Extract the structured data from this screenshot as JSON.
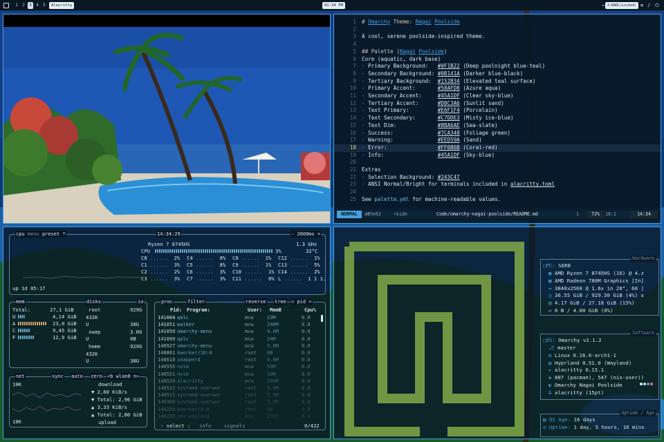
{
  "colors": {
    "accent": "#45A1DF",
    "bg": "#0B141A",
    "teal": "#152B34",
    "sand": "#D8C3A6",
    "green": "#7CA348"
  },
  "topbar": {
    "workspaces": [
      "1",
      "2",
      "3",
      "4",
      "5"
    ],
    "active_workspace": "3",
    "app_title": "Alacritty",
    "clock": "02:34 PM",
    "tray_icons": [
      "terminal-icon",
      "tag-icon",
      "bell-icon",
      "bluetooth-icon",
      "wifi-icon",
      "volume-icon",
      "battery-icon",
      "power-icon"
    ],
    "tray_label": "X:RADL(Locked)"
  },
  "editor": {
    "lines": [
      {
        "n": "1",
        "t": "# Omarchy Theme: Nagai Poolside"
      },
      {
        "n": "2",
        "t": ""
      },
      {
        "n": "3",
        "t": "A cool, serene poolside-inspired theme."
      },
      {
        "n": "4",
        "t": ""
      },
      {
        "n": "5",
        "t": "## Palette (Nagai Poolside)"
      },
      {
        "n": "6",
        "t": "Core (aquatic, dark base)"
      },
      {
        "n": "7",
        "t": "- Primary Background:   #0F1B22 (Deep poolnight blue-teal)"
      },
      {
        "n": "8",
        "t": "- Secondary Background: #0B141A (Darker blue-black)"
      },
      {
        "n": "9",
        "t": "- Tertiary Background:  #152B34 (Elevated teal surface)"
      },
      {
        "n": "10",
        "t": "- Primary Accent:       #58AFD8 (Azure aqua)"
      },
      {
        "n": "11",
        "t": "- Secondary Accent:     #45A1DF (Clear sky-blue)"
      },
      {
        "n": "12",
        "t": "- Tertiary Accent:      #D8C3A6 (Sunlit sand)"
      },
      {
        "n": "13",
        "t": "- Text Primary:         #E6F1F4 (Porcelain)"
      },
      {
        "n": "14",
        "t": "- Text Secondary:       #C7DDE3 (Misty ice-blue)"
      },
      {
        "n": "15",
        "t": "- Text Dim:             #8BA6AE (Sea-slate)"
      },
      {
        "n": "16",
        "t": "- Success:              #7CA348 (Foliage green)"
      },
      {
        "n": "17",
        "t": "- Warning:              #EED59A (Sand)"
      },
      {
        "n": "18",
        "t": "- Error:                #FF6B6B (Coral-red)"
      },
      {
        "n": "19",
        "t": "- Info:                 #45A1DF (Sky-blue)"
      },
      {
        "n": "20",
        "t": ""
      },
      {
        "n": "21",
        "t": "Extras"
      },
      {
        "n": "22",
        "t": "- Selection Background: #243C47"
      },
      {
        "n": "23",
        "t": "- ANSI Normal/Bright for terminals included in alacritty.toml"
      },
      {
        "n": "24",
        "t": ""
      },
      {
        "n": "25",
        "t": "See palette.yml for machine-readable values."
      }
    ],
    "current_line": "18",
    "status": {
      "mode": "NORMAL",
      "branch": "d45e62",
      "side": "<side",
      "path": "Code/omarchy-nagai-poolside/README.md",
      "diag": "1",
      "pct": "72%",
      "pos": "18:1",
      "time": "14:34"
    }
  },
  "btop": {
    "cpu": {
      "title": "cpu",
      "menu": "menu",
      "preset": "preset *",
      "clock": "14:34:29",
      "interval": "- 2000ms +",
      "model": "Ryzen 7 8745HS",
      "freq": "1.3 GHz",
      "total_label": "CPU",
      "total_pct": "3%",
      "temp": "32°C",
      "cores": [
        {
          "n": "C8",
          "p": "2%"
        },
        {
          "n": "C4",
          "p": "8%"
        },
        {
          "n": "C8",
          "p": "1%"
        },
        {
          "n": "C12",
          "p": "1%"
        },
        {
          "n": "C1",
          "p": "3%"
        },
        {
          "n": "C5",
          "p": "8%"
        },
        {
          "n": "C9",
          "p": "1%"
        },
        {
          "n": "C13",
          "p": "5%"
        },
        {
          "n": "C2",
          "p": "2%"
        },
        {
          "n": "C6",
          "p": "3%"
        },
        {
          "n": "C10",
          "p": "1%"
        },
        {
          "n": "C14",
          "p": "2%"
        },
        {
          "n": "C3",
          "p": "3%"
        },
        {
          "n": "C7",
          "p": "3%"
        },
        {
          "n": "C11",
          "p": "0%"
        },
        {
          "n": "L",
          "p": "1 1 1. 10%"
        }
      ],
      "uptime": "up 1d 05:17"
    },
    "mem": {
      "title": "mem",
      "disks": "disks",
      "io": "io",
      "total_label": "Total:",
      "total": "27,1 GiB",
      "rows": [
        {
          "k": "U",
          "v": "4,14 GiB"
        },
        {
          "k": "A",
          "v": "23,0 GiB"
        },
        {
          "k": "C",
          "v": "9,45 GiB"
        },
        {
          "k": "F",
          "v": "12,9 GiB"
        }
      ],
      "disks_rows": [
        {
          "k": "root",
          "v": "929G"
        },
        {
          "k": "432K",
          "v": ""
        },
        {
          "k": "U",
          "v": "38G"
        },
        {
          "k": "swap",
          "v": "3.0G"
        },
        {
          "k": "U",
          "v": "0B"
        },
        {
          "k": "home",
          "v": "929G"
        },
        {
          "k": "432K",
          "v": ""
        },
        {
          "k": "U",
          "v": "38G"
        }
      ]
    },
    "net": {
      "title": "net",
      "sync": "sync",
      "auto": "auto",
      "zero": "zero",
      "iface": "<b wlan0 n>",
      "scale_top": "10K",
      "scale_bottom": "10K",
      "download_label": "download",
      "down_rate": "2,60 KiB/s",
      "down_total": "Total: 2,96 GiB",
      "up_rate": "3,33 KiB/s",
      "up_total": "Total: 2,80 GiB",
      "upload_label": "upload"
    },
    "proc": {
      "title": "proc",
      "filter": "filter",
      "reverse": "reverse",
      "tree": "tree",
      "sort": "< pid >",
      "headers": {
        "pid": "Pid:",
        "prog": "Program:",
        "user": "User:",
        "mem": "MemB",
        "cpu": "Cpu%"
      },
      "rows": [
        {
          "pid": "141064",
          "prog": "qalc",
          "user": "mcw",
          "mem": "23M",
          "cpu": "0.0"
        },
        {
          "pid": "141051",
          "prog": "walker",
          "user": "mcw",
          "mem": "248M",
          "cpu": "0.0"
        },
        {
          "pid": "141050",
          "prog": "omarchy-menu",
          "user": "mcw",
          "mem": "4.0M",
          "cpu": "0.0"
        },
        {
          "pid": "141009",
          "prog": "qalc",
          "user": "mcw",
          "mem": "24M",
          "cpu": "0.0"
        },
        {
          "pid": "140927",
          "prog": "omarchy-menu",
          "user": "mcw",
          "mem": "5.0M",
          "cpu": "0.0"
        },
        {
          "pid": "140861",
          "prog": "kworker/10:0",
          "user": "root",
          "mem": "0B",
          "cpu": "0.0"
        },
        {
          "pid": "140618",
          "prog": "snapperd",
          "user": "root",
          "mem": "9.0M",
          "cpu": "0.0"
        },
        {
          "pid": "140555",
          "prog": "nvim",
          "user": "mcw",
          "mem": "59M",
          "cpu": "0.0"
        },
        {
          "pid": "140551",
          "prog": "nvim",
          "user": "mcw",
          "mem": "10M",
          "cpu": "0.0"
        },
        {
          "pid": "140529",
          "prog": "alacritty",
          "user": "mcw",
          "mem": "209M",
          "cpu": "0.0"
        },
        {
          "pid": "140522",
          "prog": "systemd-userwor",
          "user": "root",
          "mem": "5.0M",
          "cpu": "0.0"
        },
        {
          "pid": "140521",
          "prog": "systemd-userwor",
          "user": "root",
          "mem": "5.0M",
          "cpu": "0.0"
        },
        {
          "pid": "140369",
          "prog": "systemd-userwor",
          "user": "root",
          "mem": "5.0M",
          "cpu": "0.0"
        },
        {
          "pid": "140259",
          "prog": "kworker/4:0",
          "user": "root",
          "mem": "0B",
          "cpu": "0.0"
        },
        {
          "pid": "140228",
          "prog": "imv-wayland",
          "user": "mcw",
          "mem": "258M",
          "cpu": "0.0"
        }
      ],
      "footer_select": "select",
      "footer_info": "info",
      "footer_signals": "signals",
      "count": "0/422"
    }
  },
  "fastfetch": {
    "hardware_label": "Hardware",
    "software_label": "Software",
    "uptime_label": "Uptime / Age",
    "pc": {
      "k": "PC:",
      "v": "SER8"
    },
    "hw": [
      {
        "icon": "cpu-icon",
        "v": "AMD Ryzen 7 8745HS (16) @ 4.z"
      },
      {
        "icon": "gpu-icon",
        "v": "AMD Radeon 780M Graphics [In]"
      },
      {
        "icon": "display-icon",
        "v": "3840x2560 @ 1.6x in 28\", 60 ]"
      },
      {
        "icon": "disk-icon",
        "v": "36.55 GiB / 929.50 GiB (4%) s"
      },
      {
        "icon": "memory-icon",
        "v": "4.17 GiB / 27.18 GiB (15%)"
      },
      {
        "icon": "swap-icon",
        "v": "0 B / 4.00 GiB (0%)"
      }
    ],
    "os": {
      "k": "OS:",
      "v": "Omarchy v2.1.2"
    },
    "sw": [
      {
        "icon": "branch-icon",
        "v": "master"
      },
      {
        "icon": "kernel-icon",
        "v": "Linux 6.16.6-arch1-1"
      },
      {
        "icon": "wm-icon",
        "v": "Hyprland 0.51.0 (Wayland)"
      },
      {
        "icon": "terminal-icon",
        "v": "alacritty 0.15.1"
      },
      {
        "icon": "package-icon",
        "v": "887 (pacman), 547 (nix-user))"
      },
      {
        "icon": "theme-icon",
        "v": "Omarchy Nagai Poolside"
      },
      {
        "icon": "font-icon",
        "v": "alacritty (15pt)"
      }
    ],
    "age": {
      "k": "OS Age:",
      "v": "16 days"
    },
    "uptime": {
      "k": "Uptime:",
      "v": "1 day, 5 hours, 16 mins"
    }
  }
}
